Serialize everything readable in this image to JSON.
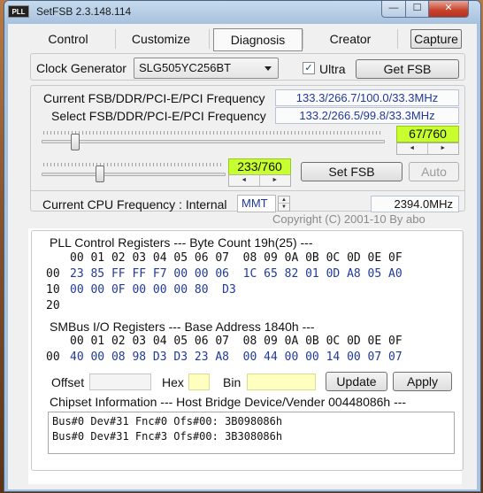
{
  "window": {
    "app_icon_text": "PLL",
    "title": "SetFSB 2.3.148.114",
    "minimize": "—",
    "maximize": "☐",
    "close": "✕"
  },
  "tabs": [
    {
      "label": "Control"
    },
    {
      "label": "Customize"
    },
    {
      "label": "Diagnosis"
    },
    {
      "label": "Creator"
    }
  ],
  "capture_label": "Capture",
  "clock": {
    "label": "Clock Generator",
    "selected": "SLG505YC256BT",
    "ultra_label": "Ultra",
    "ultra_checked": "✓",
    "get_fsb": "Get FSB"
  },
  "freq": {
    "current_label": "Current FSB/DDR/PCI-E/PCI Frequency",
    "current_value": "133.3/266.7/100.0/33.3MHz",
    "select_label": "Select FSB/DDR/PCI-E/PCI Frequency",
    "select_value": "133.2/266.5/99.8/33.3MHz"
  },
  "slider1": {
    "value_text": "67/760",
    "fraction": 0.088
  },
  "slider2": {
    "value_text": "233/760",
    "fraction": 0.306
  },
  "spin_left": "◄",
  "spin_right": "►",
  "spin_up": "▲",
  "spin_down": "▼",
  "set_fsb": "Set FSB",
  "auto": "Auto",
  "cpu": {
    "label": "Current CPU Frequency : Internal",
    "mode": "MMT",
    "value": "2394.0MHz"
  },
  "copyright": "Copyright (C) 2001-10 By abo",
  "pll": {
    "header": "PLL Control Registers  --- Byte Count 19h(25) ---",
    "col_headers": "00 01 02 03 04 05 06 07  08 09 0A 0B 0C 0D 0E 0F",
    "rows": [
      {
        "addr": "00",
        "values": "23 85 FF FF F7 00 00 06  1C 65 82 01 0D A8 05 A0"
      },
      {
        "addr": "10",
        "values": "00 00 0F 00 00 00 80  D3"
      },
      {
        "addr": "20",
        "values": ""
      }
    ]
  },
  "smbus": {
    "header": "SMBus I/O Registers  --- Base Address 1840h ---",
    "col_headers": "00 01 02 03 04 05 06 07  08 09 0A 0B 0C 0D 0E 0F",
    "rows": [
      {
        "addr": "00",
        "values": "40 00 08 98 D3 D3 23 A8  00 44 00 00 14 00 07 07"
      }
    ]
  },
  "edit": {
    "offset_label": "Offset",
    "hex_label": "Hex",
    "bin_label": "Bin",
    "update": "Update",
    "apply": "Apply"
  },
  "chipset": {
    "header": "Chipset Information  --- Host Bridge Device/Vender 00448086h ---",
    "lines": [
      "Bus#0 Dev#31 Fnc#0 Ofs#00: 3B098086h",
      "Bus#0 Dev#31 Fnc#3 Ofs#00: 3B308086h"
    ]
  }
}
